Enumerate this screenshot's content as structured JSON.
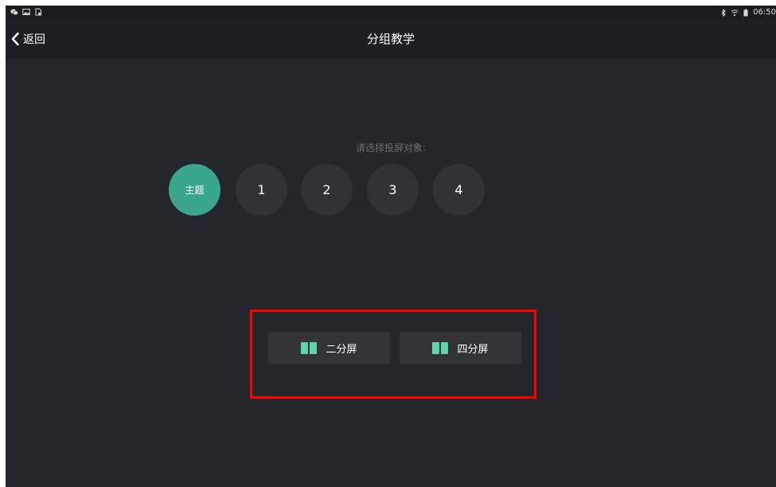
{
  "status_bar": {
    "left_icons": [
      "wechat-icon",
      "image-icon",
      "download-icon"
    ],
    "right_icons": [
      "bluetooth-icon",
      "wifi-icon",
      "battery-icon"
    ],
    "time": "06:50"
  },
  "nav": {
    "back_label": "返回",
    "title": "分组教学"
  },
  "main": {
    "prompt": "请选择投屏对象:",
    "targets": [
      {
        "label": "主题",
        "selected": true
      },
      {
        "label": "1",
        "selected": false
      },
      {
        "label": "2",
        "selected": false
      },
      {
        "label": "3",
        "selected": false
      },
      {
        "label": "4",
        "selected": false
      }
    ],
    "split_options": [
      {
        "label": "二分屏",
        "icon": "split-screen-icon"
      },
      {
        "label": "四分屏",
        "icon": "split-screen-icon"
      }
    ]
  },
  "colors": {
    "background": "#25262b",
    "navbar": "#1e1f23",
    "accent": "#3aa68a",
    "button": "#323338",
    "highlight": "#ff0000"
  }
}
